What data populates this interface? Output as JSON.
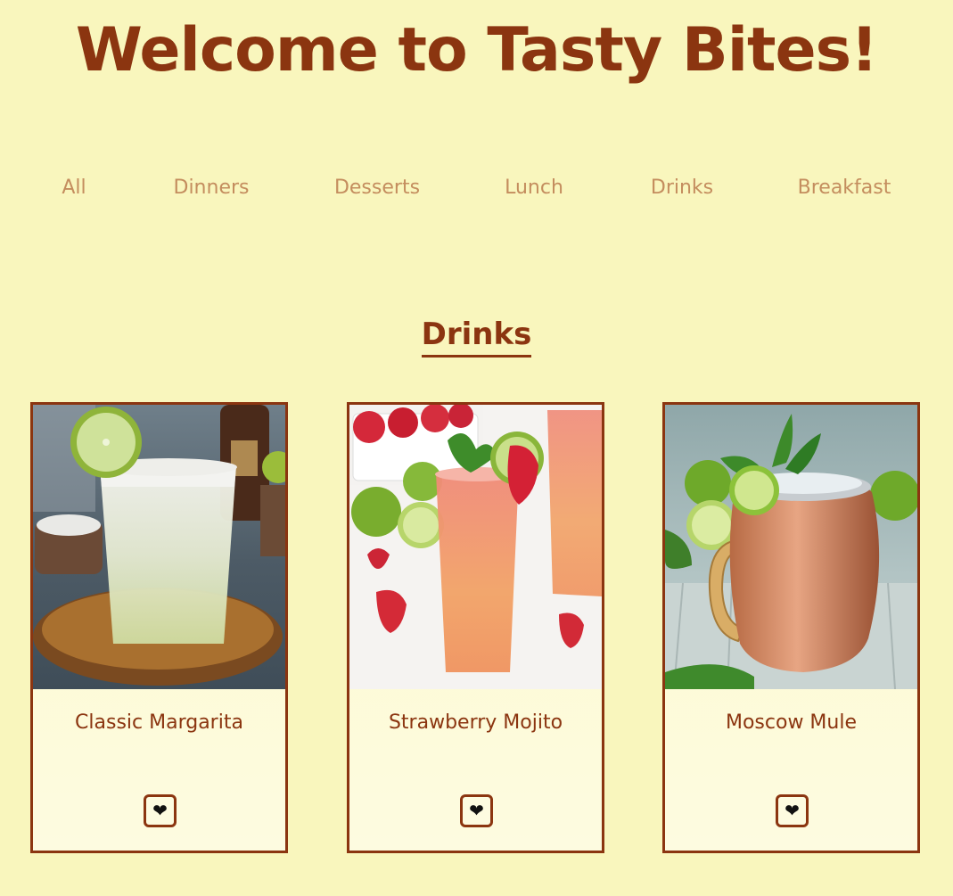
{
  "header": {
    "title": "Welcome to Tasty Bites!"
  },
  "nav": {
    "items": [
      {
        "label": "All"
      },
      {
        "label": "Dinners"
      },
      {
        "label": "Desserts"
      },
      {
        "label": "Lunch"
      },
      {
        "label": "Drinks"
      },
      {
        "label": "Breakfast"
      }
    ]
  },
  "section": {
    "heading": "Drinks"
  },
  "cards": [
    {
      "title": "Classic Margarita",
      "favorite_icon": "heart-icon",
      "favorite_glyph": "❤"
    },
    {
      "title": "Strawberry Mojito",
      "favorite_icon": "heart-icon",
      "favorite_glyph": "❤"
    },
    {
      "title": "Moscow Mule",
      "favorite_icon": "heart-icon",
      "favorite_glyph": "❤"
    }
  ],
  "colors": {
    "background": "#f9f6bd",
    "accent": "#8b3510",
    "nav_text": "#c48d5e",
    "card_background": "#fdfacc"
  }
}
